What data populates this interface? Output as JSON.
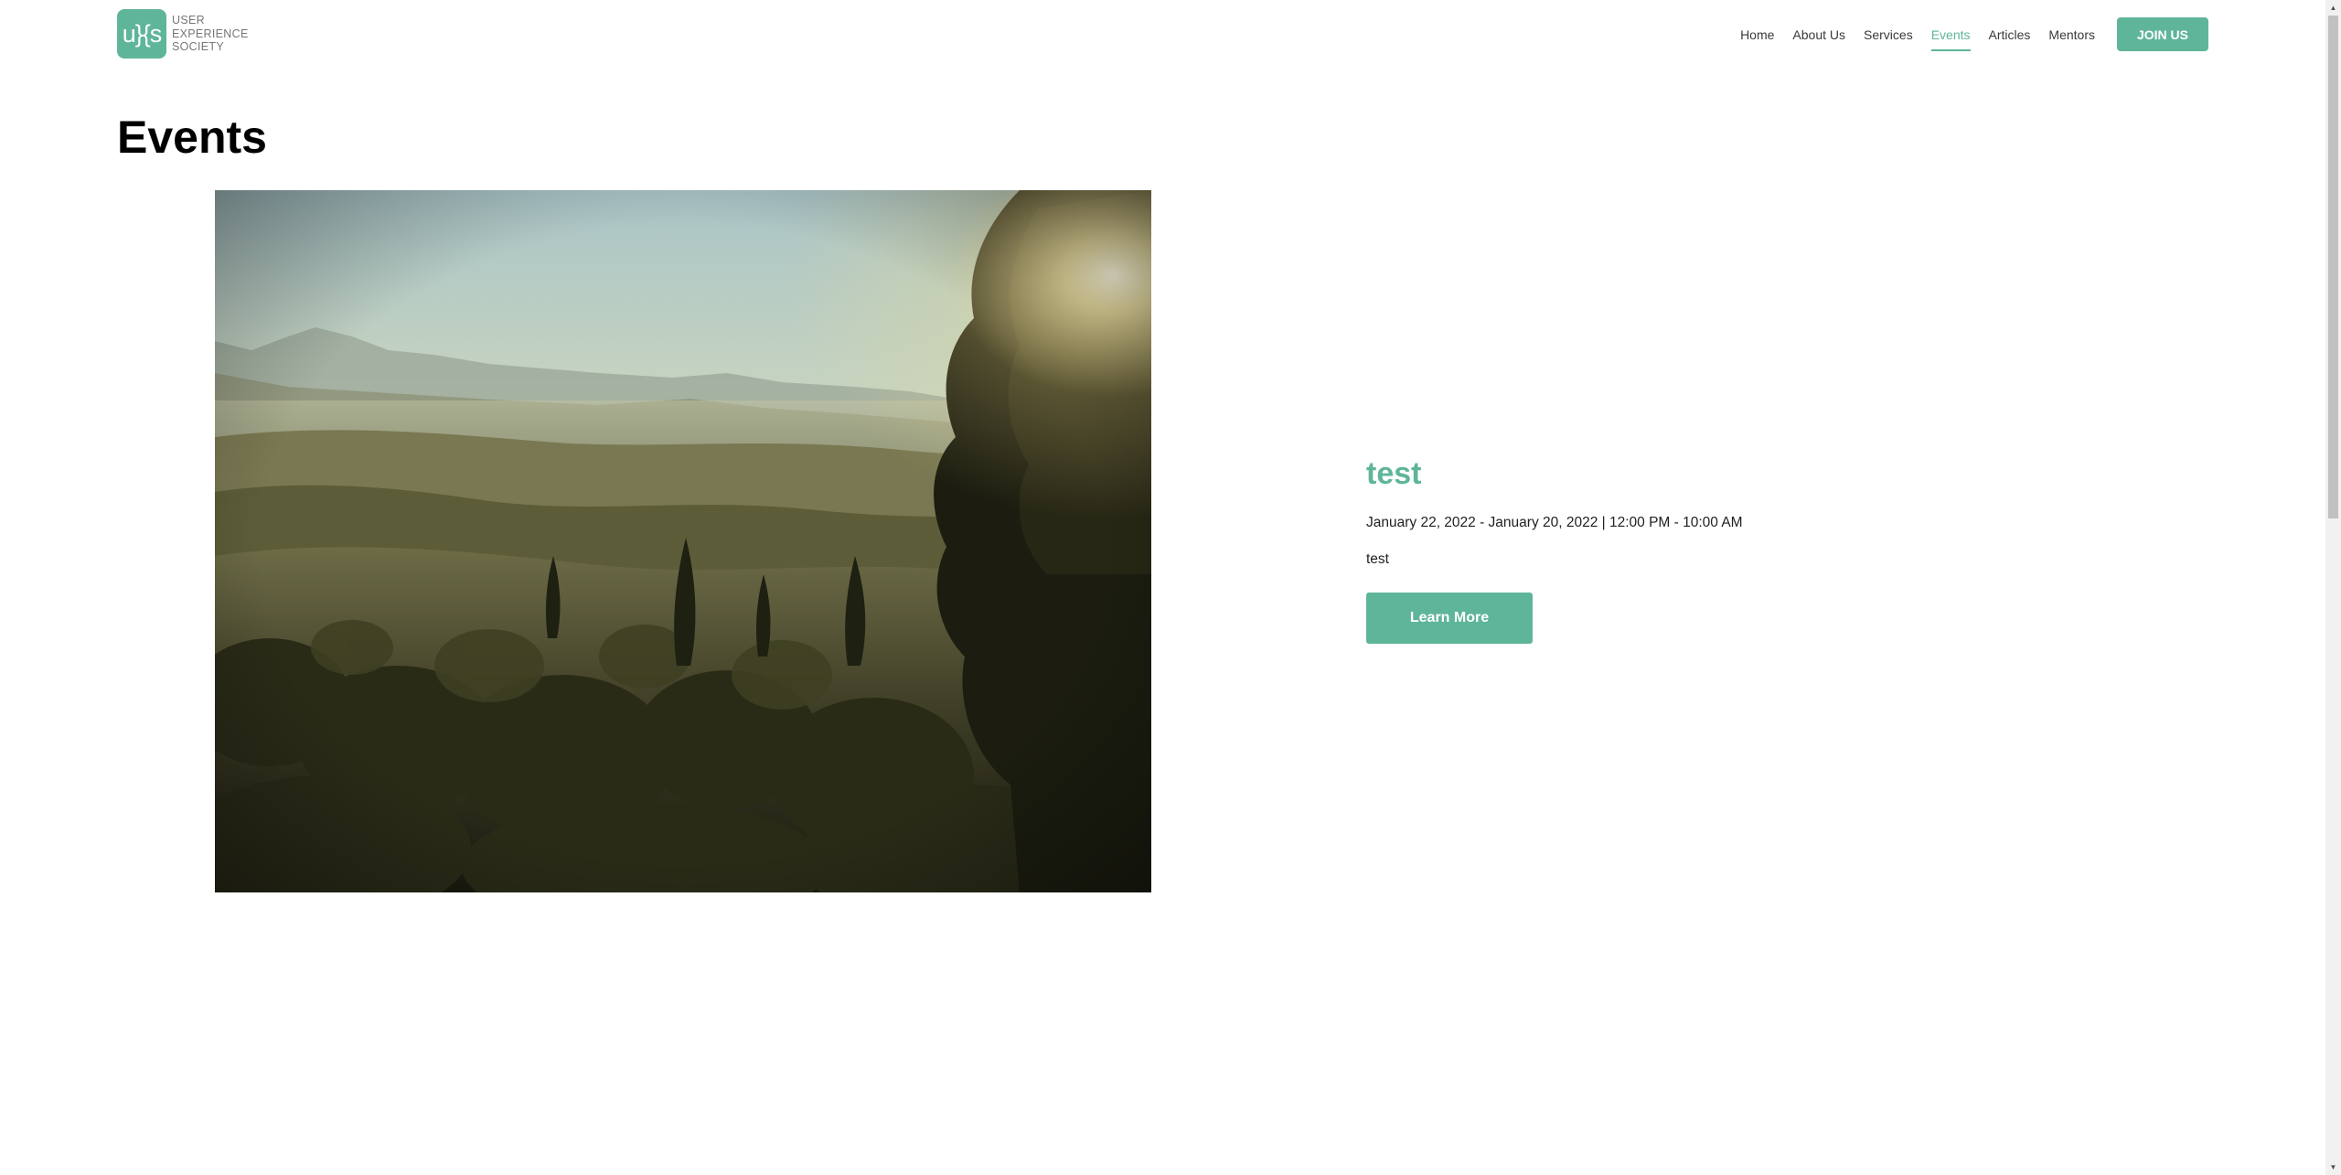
{
  "header": {
    "logo_mark": "u}{s",
    "logo_lines": [
      "USER",
      "EXPERIENCE",
      "SOCIETY"
    ],
    "nav": [
      {
        "label": "Home",
        "active": false
      },
      {
        "label": "About Us",
        "active": false
      },
      {
        "label": "Services",
        "active": false
      },
      {
        "label": "Events",
        "active": true
      },
      {
        "label": "Articles",
        "active": false
      },
      {
        "label": "Mentors",
        "active": false
      }
    ],
    "join_label": "JOIN US"
  },
  "main": {
    "title": "Events",
    "event": {
      "image": "landscape-photo",
      "title": "test",
      "date": "January 22, 2022 - January 20, 2022 | 12:00 PM - 10:00 AM",
      "description": "test",
      "button_label": "Learn More"
    }
  },
  "colors": {
    "accent": "#5fb59a",
    "text": "#111111",
    "background": "#ffffff"
  },
  "scrollbar": {
    "up_icon": "caret-up-icon",
    "down_icon": "caret-down-icon"
  }
}
